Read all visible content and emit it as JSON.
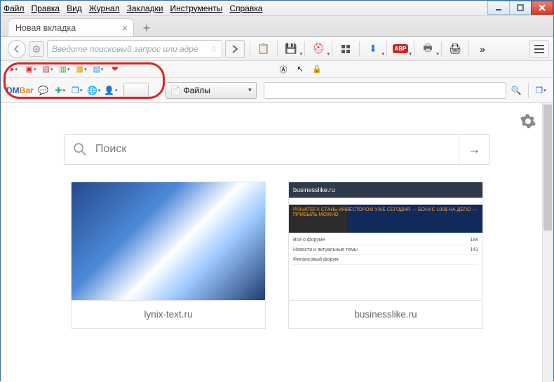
{
  "menubar": {
    "items": [
      "Файл",
      "Правка",
      "Вид",
      "Журнал",
      "Закладки",
      "Инструменты",
      "Справка"
    ]
  },
  "tab": {
    "title": "Новая вкладка"
  },
  "addressbar": {
    "placeholder": "Введите поисковый запрос или адре"
  },
  "toolbar": {
    "abp_label": "ABP"
  },
  "dmbar": {
    "label_dm": "DM",
    "label_bar": "Bar"
  },
  "files_dropdown": {
    "label": "Файлы"
  },
  "bigsearch": {
    "placeholder": "Поиск"
  },
  "tiles": [
    {
      "caption": "lynix-text.ru"
    },
    {
      "caption": "businesslike.ru",
      "header": "businesslike.ru",
      "banner": "PRIVATEFX  СТАНЬ ИНВЕСТОРОМ УЖЕ СЕГОДНЯ — БОНУС 100$ НА ДЕПО — ПРИБЫЛЬ МОЖНО"
    }
  ]
}
